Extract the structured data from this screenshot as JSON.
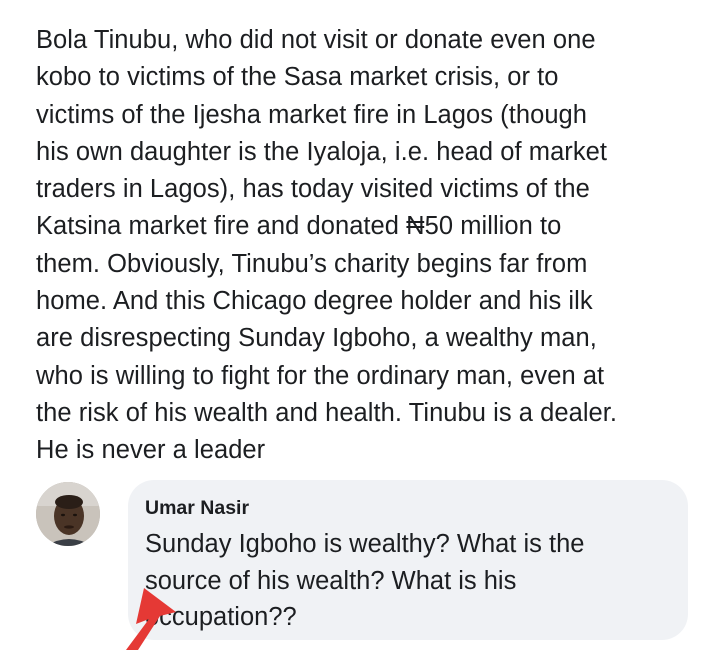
{
  "post": {
    "lines": [
      "Bola Tinubu, who did not visit or donate even  one",
      "kobo to victims of the Sasa market crisis, or to",
      "victims of the Ijesha market fire in Lagos (though",
      "his own daughter is the Iyaloja, i.e. head of market",
      "traders in Lagos), has today visited  victims of the",
      "Katsina market fire and donated ₦50 million to",
      "them.  Obviously, Tinubu’s charity begins far from",
      "home. And this Chicago degree holder and his ilk",
      "are disrespecting Sunday Igboho, a wealthy man,",
      "who is willing to fight for the ordinary man, even at",
      "the risk of his wealth and health. Tinubu is a dealer.",
      "He is never a leader"
    ]
  },
  "comment": {
    "author": "Umar Nasir",
    "lines": [
      "Sunday Igboho is wealthy? What is the",
      "source of his wealth? What is his",
      "occupation??"
    ]
  },
  "colors": {
    "text": "#1c1e21",
    "bubble": "#f0f2f5",
    "arrow": "#e53935"
  },
  "icons": {
    "avatar": "profile-photo",
    "annotation": "red-arrow-icon"
  }
}
